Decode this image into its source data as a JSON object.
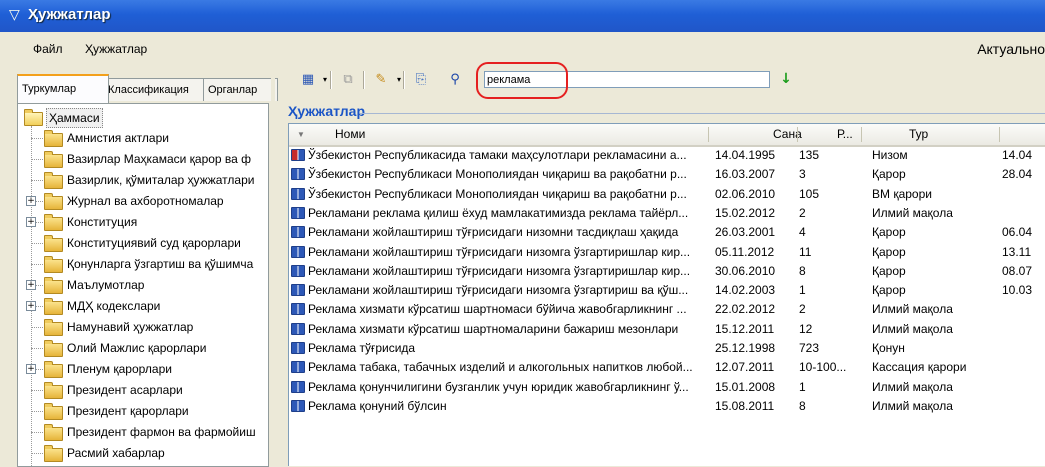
{
  "window": {
    "title": "Ҳужжатлар",
    "app_icon": "filter-funnel-icon"
  },
  "menu": {
    "items": [
      "Файл",
      "Ҳужжатлар"
    ],
    "right_text": "Актуально"
  },
  "left_tabs": [
    "Туркумлар",
    "Классификация",
    "Органлар"
  ],
  "tree": {
    "root": "Ҳаммаси",
    "items": [
      {
        "label": "Амнистия актлари",
        "expandable": false
      },
      {
        "label": "Вазирлар Маҳкамаси қарор ва ф",
        "expandable": false
      },
      {
        "label": "Вазирлик, қўмиталар ҳужжатлари",
        "expandable": false
      },
      {
        "label": "Журнал ва ахборотномалар",
        "expandable": true
      },
      {
        "label": "Конституция",
        "expandable": true
      },
      {
        "label": "Конституциявий суд қарорлари",
        "expandable": false
      },
      {
        "label": "Қонунларга ўзгартиш ва қўшимча",
        "expandable": false
      },
      {
        "label": "Маълумотлар",
        "expandable": true
      },
      {
        "label": "МДҲ кодекслари",
        "expandable": true
      },
      {
        "label": "Намунавий ҳужжатлар",
        "expandable": false
      },
      {
        "label": "Олий Мажлис қарорлари",
        "expandable": false
      },
      {
        "label": "Пленум қарорлари",
        "expandable": true
      },
      {
        "label": "Президент асарлари",
        "expandable": false
      },
      {
        "label": "Президент қарорлари",
        "expandable": false
      },
      {
        "label": "Президент фармон ва фармойиш",
        "expandable": false
      },
      {
        "label": "Расмий хабарлар",
        "expandable": false
      }
    ]
  },
  "toolbar": {
    "search_value": "реклама",
    "go_icon": "green-down-arrow-icon"
  },
  "documents": {
    "title": "Ҳужжатлар",
    "columns": [
      "Номи",
      "Сана",
      "Р...",
      "Тур"
    ],
    "rows": [
      [
        "Ўзбекистон Республикасида тамаки маҳсулотлари рекламасини а...",
        "14.04.1995",
        "135",
        "Низом",
        "14.04"
      ],
      [
        "Ўзбекистон Республикаси Монополиядан чиқариш ва рақобатни р...",
        "16.03.2007",
        "3",
        "Қарор",
        "28.04"
      ],
      [
        "Ўзбекистон Республикаси Монополиядан чиқариш ва рақобатни р...",
        "02.06.2010",
        "105",
        "ВМ қарори",
        ""
      ],
      [
        "Рекламани реклама қилиш ёхуд мамлакатимизда реклама тайёрл...",
        "15.02.2012",
        "2",
        "Илмий мақола",
        ""
      ],
      [
        "Рекламани жойлаштириш тўғрисидаги низомни тасдиқлаш ҳақида",
        "26.03.2001",
        "4",
        "Қарор",
        "06.04"
      ],
      [
        "Рекламани жойлаштириш тўғрисидаги низомга ўзгартиришлар кир...",
        "05.11.2012",
        "11",
        "Қарор",
        "13.11"
      ],
      [
        "Рекламани жойлаштириш тўғрисидаги низомга ўзгартиришлар кир...",
        "30.06.2010",
        "8",
        "Қарор",
        "08.07"
      ],
      [
        "Рекламани жойлаштириш тўғрисидаги низомга ўзгартириш ва қўш...",
        "14.02.2003",
        "1",
        "Қарор",
        "10.03"
      ],
      [
        "Реклама хизмати кўрсатиш шартномаси бўйича жавобгарликнинг ...",
        "22.02.2012",
        "2",
        "Илмий мақола",
        ""
      ],
      [
        "Реклама хизмати кўрсатиш шартномаларини бажариш мезонлари",
        "15.12.2011",
        "12",
        "Илмий мақола",
        ""
      ],
      [
        "Реклама тўғрисида",
        "25.12.1998",
        "723",
        "Қонун",
        ""
      ],
      [
        "Реклама табака, табачных изделий и алкогольных напитков любой...",
        "12.07.2011",
        "10-100...",
        "Кассация қарори",
        ""
      ],
      [
        "Реклама қонунчилигини бузганлик учун юридик жавобгарликнинг ў...",
        "15.01.2008",
        "1",
        "Илмий мақола",
        ""
      ],
      [
        "Реклама қонуний бўлсин",
        "15.08.2011",
        "8",
        "Илмий мақола",
        ""
      ]
    ]
  }
}
